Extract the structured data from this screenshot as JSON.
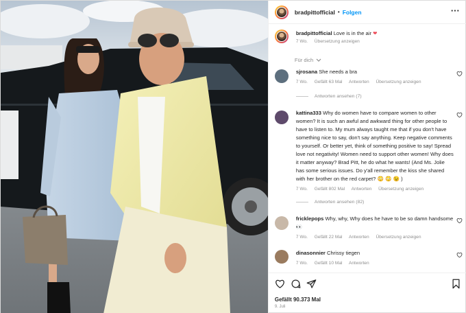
{
  "header": {
    "username": "bradpittofficial",
    "separator": "•",
    "follow_label": "Folgen",
    "more_icon": "ellipsis-icon"
  },
  "caption": {
    "username": "bradpittofficial",
    "text": "Love is in the air",
    "emoji": "❤",
    "time": "7 Wo.",
    "translate_label": "Übersetzung anzeigen"
  },
  "fuer_dich_label": "Für dich",
  "comments": [
    {
      "username": "sjrosana",
      "text": "She needs a bra",
      "time": "7 Wo.",
      "likes": "Gefällt 63 Mal",
      "reply": "Antworten",
      "translate": "Übersetzung anzeigen",
      "view_replies": "Antworten ansehen (7)"
    },
    {
      "username": "kattina333",
      "text": "Why do women have to compare women to other women? It is such an awful and awkward thing for other people to have to listen to. My mum always taught me that if you don't have something nice to say, don't say anything. Keep negative comments to yourself. Or better yet, think of something positive to say! Spread love not negativity! Women need to support other women! Why does it matter anyway? Brad Pitt, he do what he wants! (And Ms. Jolie has some serious issues. Do y'all remember the kiss she shared with her brother on the red carpet? 😳 😳 😉 )",
      "time": "7 Wo.",
      "likes": "Gefällt 802 Mal",
      "reply": "Antworten",
      "translate": "Übersetzung anzeigen",
      "view_replies": "Antworten ansehen (82)"
    },
    {
      "username": "fricklepops",
      "text": "Why, why, Why does he have to be so damn handsome 👀",
      "time": "7 Wo.",
      "likes": "Gefällt 22 Mal",
      "reply": "Antworten",
      "translate": "Übersetzung anzeigen"
    },
    {
      "username": "dinasonnier",
      "text": "Chrissy tiegen",
      "time": "7 Wo.",
      "likes": "Gefällt 10 Mal",
      "reply": "Antworten"
    }
  ],
  "footer": {
    "likes": "Gefällt 90.373 Mal",
    "date": "9. Juli"
  },
  "icons": {
    "like": "heart-icon",
    "comment": "comment-icon",
    "share": "share-icon",
    "save": "bookmark-icon"
  },
  "colors": {
    "accent": "#0095f6",
    "heart": "#ed4956",
    "muted": "#8e8e8e"
  }
}
